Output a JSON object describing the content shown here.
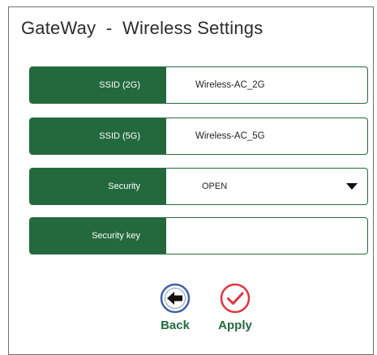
{
  "window": {
    "title": "GateWay  -  Wireless Settings"
  },
  "form": {
    "ssid_2g": {
      "label": "SSID  (2G)",
      "value": "Wireless-AC_2G"
    },
    "ssid_5g": {
      "label": "SSID  (5G)",
      "value": "Wireless-AC_5G"
    },
    "security": {
      "label": "Security",
      "selected": "OPEN"
    },
    "security_key": {
      "label": "Security key",
      "value": ""
    }
  },
  "actions": {
    "back_label": "Back",
    "apply_label": "Apply"
  },
  "icons": {
    "back": "arrow-left-circle-icon",
    "apply": "checkmark-circle-icon",
    "dropdown": "caret-down-icon"
  },
  "colors": {
    "accent_green": "#23693d",
    "back_icon_blue": "#3f5fa6",
    "apply_icon_red": "#e0333e"
  }
}
